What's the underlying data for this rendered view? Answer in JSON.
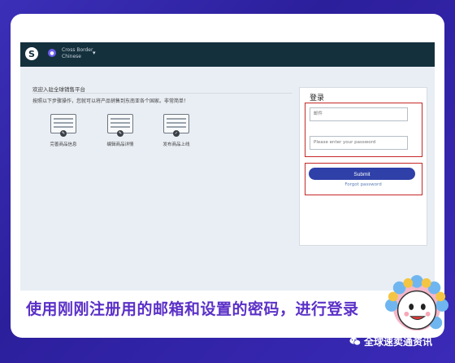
{
  "topbar": {
    "store_name": "Cross Border",
    "store_lang": "Chinese",
    "caret": "▾"
  },
  "main": {
    "welcome": "欢迎入驻全球销售平台",
    "intro": "按照以下步骤操作，您就可以将产品销售到东南亚各个国家。非常简单！",
    "steps": [
      {
        "label": "完善商品信息"
      },
      {
        "label": "编辑商品详情"
      },
      {
        "label": "发布商品上线"
      }
    ]
  },
  "login": {
    "title": "登录",
    "email_placeholder": "邮件",
    "password_placeholder": "Please enter your password",
    "submit_label": "Submit",
    "forgot_label": "Forgot password"
  },
  "caption": "使用刚刚注册用的邮箱和设置的密码，进行登录",
  "brand": "全球速卖通资讯",
  "colors": {
    "background": "#3b2fb8",
    "topbar": "#14303d",
    "highlight": "#c62828",
    "submit": "#2f40a8",
    "caption": "#5b30c7"
  }
}
